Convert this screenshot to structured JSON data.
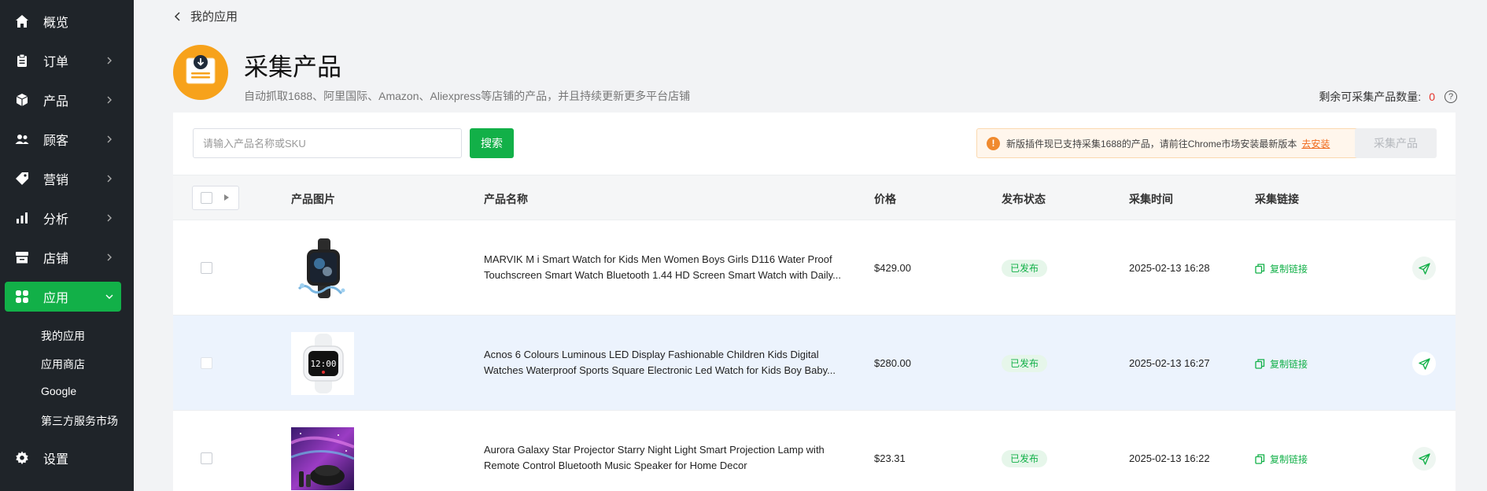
{
  "sidebar": {
    "items": [
      {
        "label": "概览",
        "icon": "home-icon"
      },
      {
        "label": "订单",
        "icon": "clipboard-icon"
      },
      {
        "label": "产品",
        "icon": "box-icon"
      },
      {
        "label": "顾客",
        "icon": "users-icon"
      },
      {
        "label": "营销",
        "icon": "tag-icon"
      },
      {
        "label": "分析",
        "icon": "bar-chart-icon"
      },
      {
        "label": "店铺",
        "icon": "store-icon"
      },
      {
        "label": "应用",
        "icon": "apps-icon",
        "active": true
      }
    ],
    "sub_items": [
      "我的应用",
      "应用商店",
      "Google",
      "第三方服务市场"
    ],
    "settings": {
      "label": "设置",
      "icon": "gear-icon"
    }
  },
  "header": {
    "back_label": "我的应用",
    "title": "采集产品",
    "description": "自动抓取1688、阿里国际、Amazon、Aliexpress等店铺的产品，并且持续更新更多平台店铺",
    "remaining_label": "剩余可采集产品数量:",
    "remaining_count": "0"
  },
  "toolbar": {
    "search_placeholder": "请输入产品名称或SKU",
    "search_button": "搜索",
    "notice_text": "新版插件现已支持采集1688的产品，请前往Chrome市场安装最新版本",
    "notice_link": "去安装",
    "collect_button": "采集产品"
  },
  "table": {
    "columns": [
      "产品图片",
      "产品名称",
      "价格",
      "发布状态",
      "采集时间",
      "采集链接"
    ],
    "rows": [
      {
        "name": "MARVIK M i Smart Watch for Kids Men Women Boys Girls D116 Water Proof Touchscreen Smart Watch Bluetooth 1.44 HD Screen Smart Watch with Daily...",
        "price": "$429.00",
        "status": "已发布",
        "time": "2025-02-13 16:28",
        "link_label": "复制链接"
      },
      {
        "name": "Acnos 6 Colours Luminous LED Display Fashionable Children Kids Digital Watches Waterproof Sports Square Electronic Led Watch for Kids Boy Baby...",
        "price": "$280.00",
        "status": "已发布",
        "time": "2025-02-13 16:27",
        "link_label": "复制链接"
      },
      {
        "name": "Aurora Galaxy Star Projector Starry Night Light Smart Projection Lamp with Remote Control Bluetooth Music Speaker for Home Decor",
        "price": "$23.31",
        "status": "已发布",
        "time": "2025-02-13 16:22",
        "link_label": "复制链接"
      }
    ],
    "image_overlay_text": "12:00"
  },
  "colors": {
    "primary": "#12b048",
    "sidebar_bg": "#1f2429",
    "app_icon": "#f7a21b",
    "warning": "#f08a2e",
    "danger": "#e5332a"
  }
}
